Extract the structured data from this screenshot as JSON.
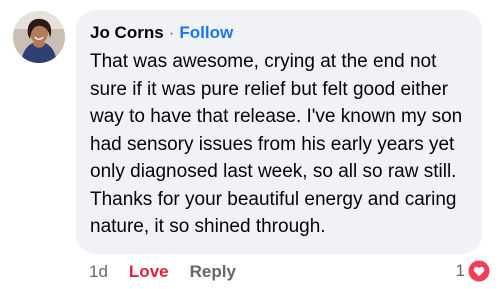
{
  "comment": {
    "author": "Jo Corns",
    "separator": "·",
    "follow_label": "Follow",
    "text": "That was awesome, crying at the end not sure if it was pure relief but felt good either way to have that release. I've known my son had sensory issues from his early years yet only diagnosed last week, so all so raw still. Thanks for your beautiful energy and caring nature, it so shined through."
  },
  "actions": {
    "time": "1d",
    "love_label": "Love",
    "reply_label": "Reply"
  },
  "reactions": {
    "count": "1",
    "icon": "heart-icon",
    "color": "#f33e58"
  },
  "colors": {
    "bubble": "#f0f2f5",
    "link": "#1877f2",
    "love": "#e41e3f",
    "muted": "#65676b"
  }
}
